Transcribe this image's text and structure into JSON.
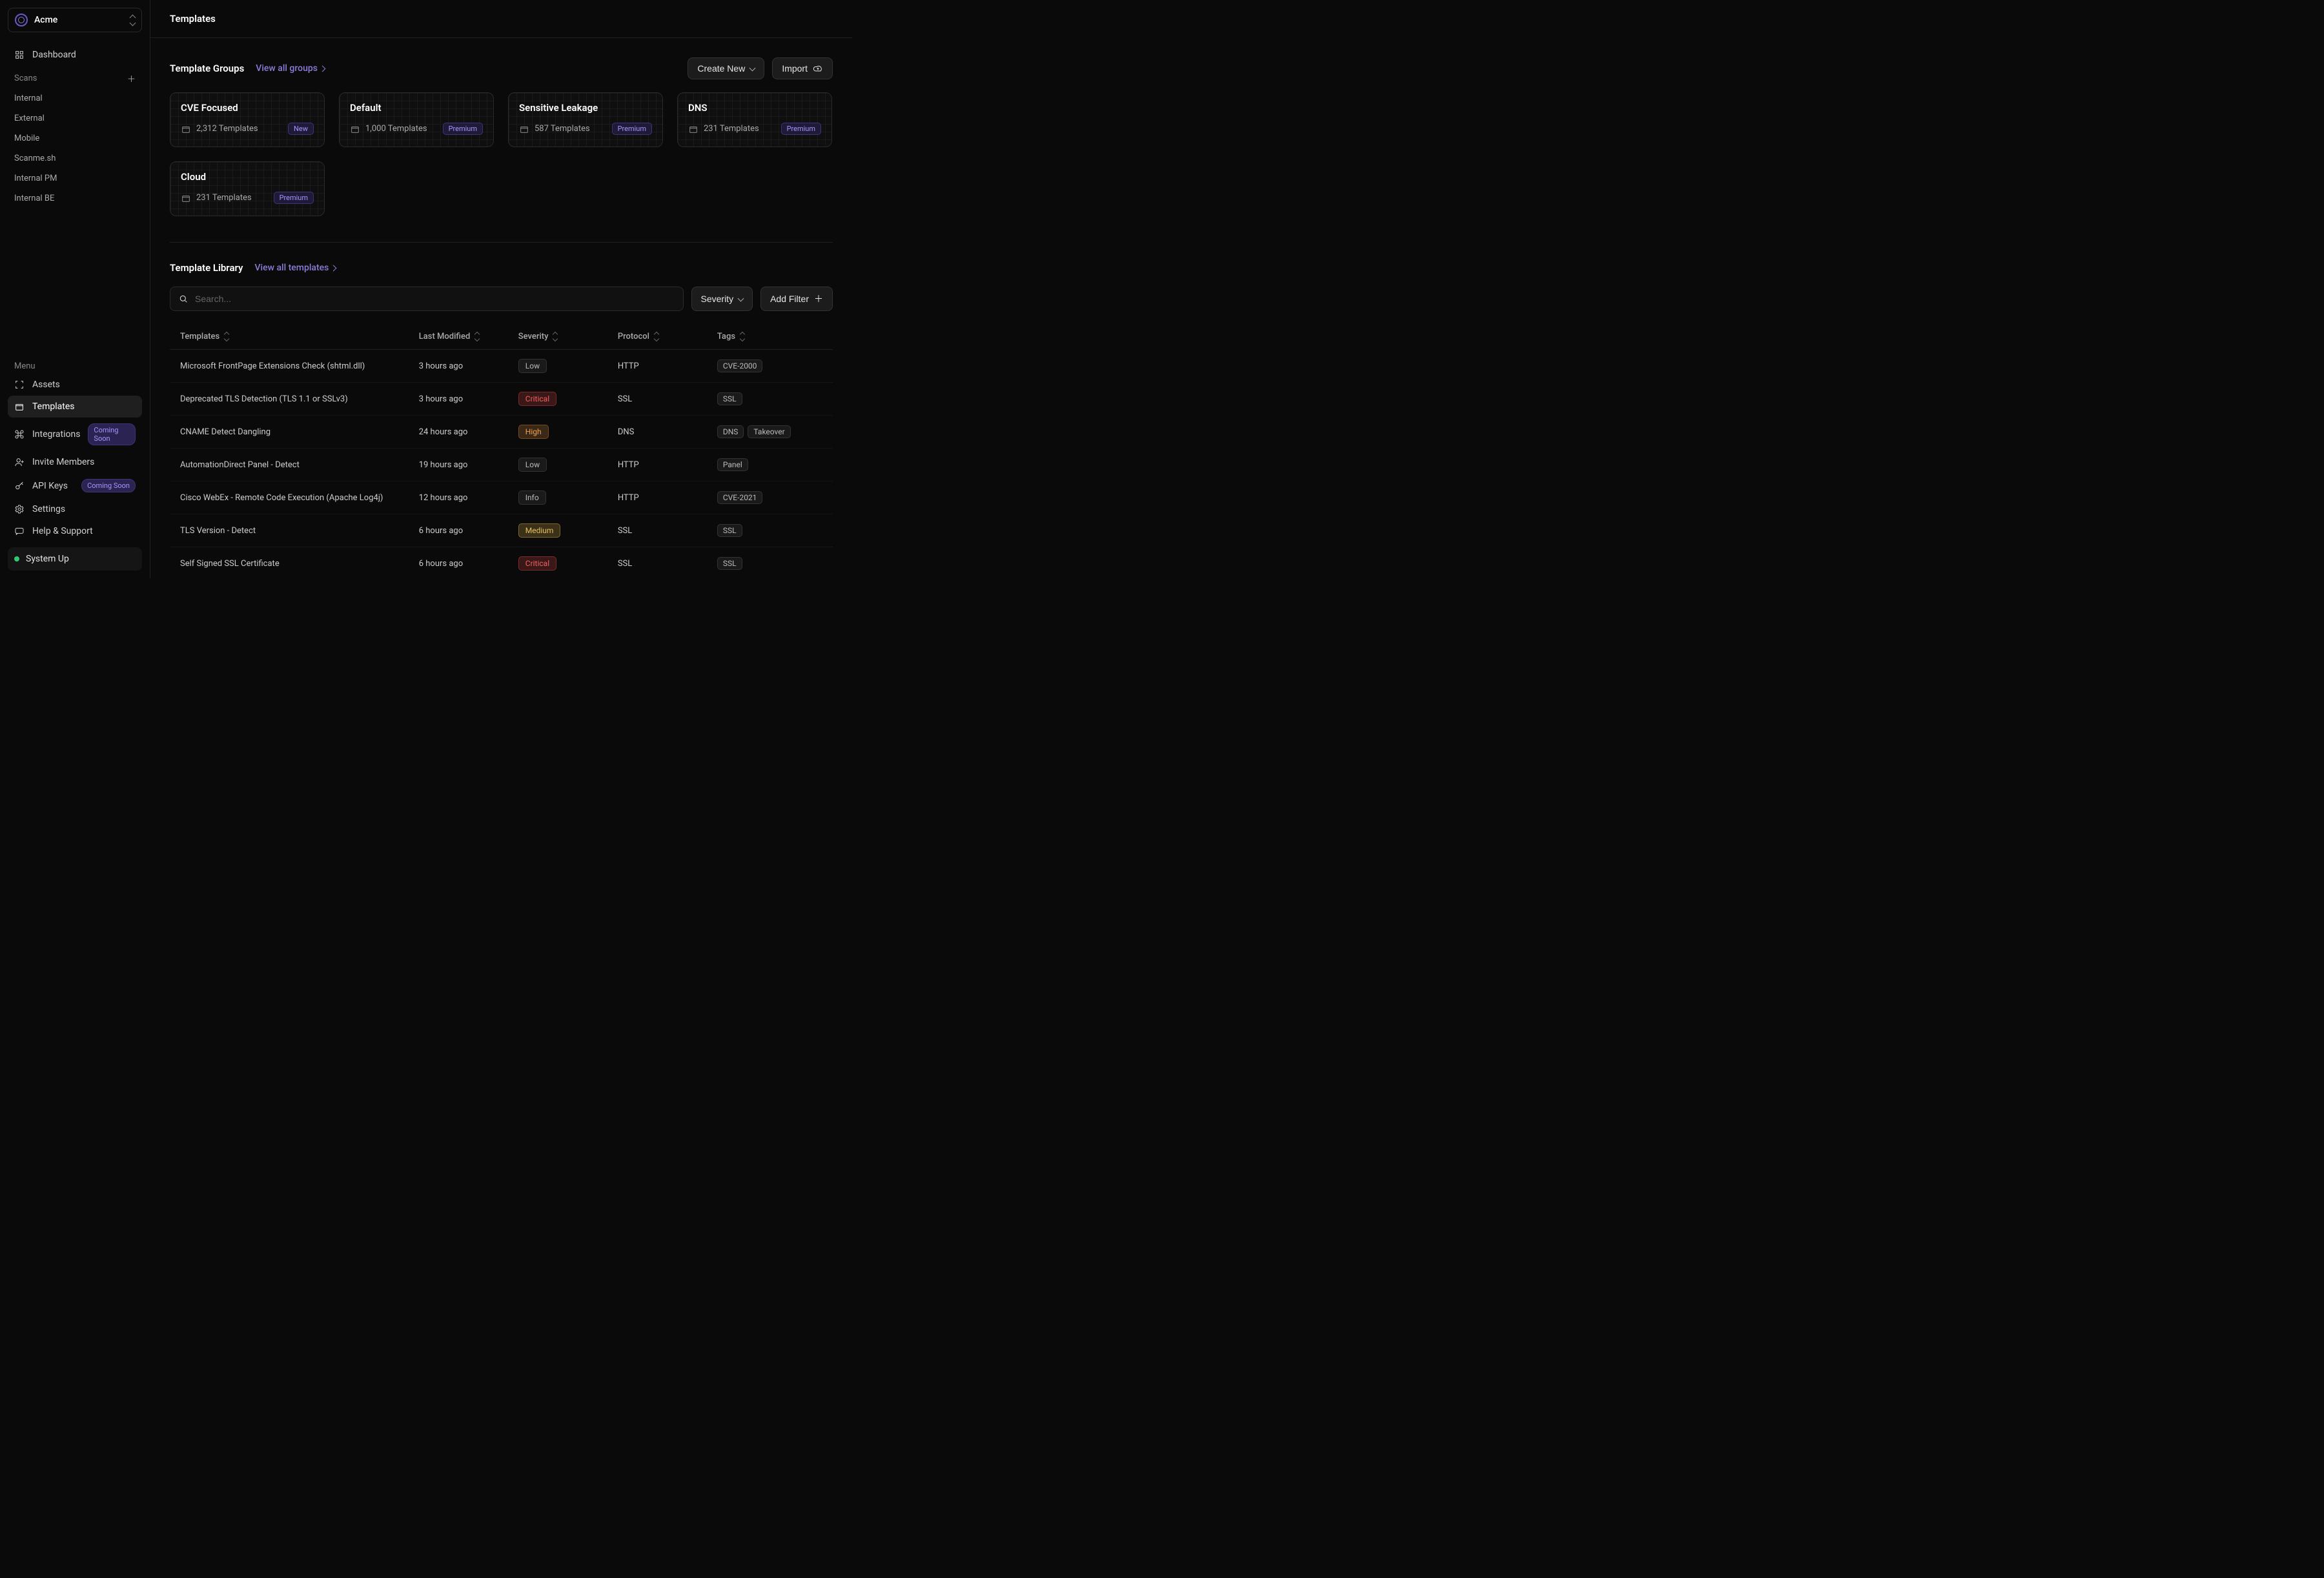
{
  "org": {
    "name": "Acme"
  },
  "sidebar": {
    "dashboard": "Dashboard",
    "scans_label": "Scans",
    "scans": [
      "Internal",
      "External",
      "Mobile",
      "Scanme.sh",
      "Internal PM",
      "Internal BE"
    ],
    "menu_label": "Menu",
    "assets": "Assets",
    "templates": "Templates",
    "integrations": "Integrations",
    "invite": "Invite Members",
    "apikeys": "API Keys",
    "settings": "Settings",
    "help": "Help & Support",
    "coming_soon": "Coming Soon",
    "system_status": "System Up"
  },
  "page": {
    "title": "Templates"
  },
  "groups": {
    "heading": "Template Groups",
    "view_all": "View all groups",
    "create_new": "Create New",
    "import": "Import",
    "cards": [
      {
        "title": "CVE Focused",
        "count": "2,312 Templates",
        "badge": "New"
      },
      {
        "title": "Default",
        "count": "1,000 Templates",
        "badge": "Premium"
      },
      {
        "title": "Sensitive Leakage",
        "count": "587 Templates",
        "badge": "Premium"
      },
      {
        "title": "DNS",
        "count": "231 Templates",
        "badge": "Premium"
      },
      {
        "title": "Cloud",
        "count": "231 Templates",
        "badge": "Premium"
      }
    ]
  },
  "library": {
    "heading": "Template Library",
    "view_all": "View all templates",
    "search_placeholder": "Search...",
    "severity_btn": "Severity",
    "add_filter": "Add Filter",
    "cols": {
      "templates": "Templates",
      "last_modified": "Last Modified",
      "severity": "Severity",
      "protocol": "Protocol",
      "tags": "Tags"
    },
    "rows": [
      {
        "name": "Microsoft FrontPage Extensions Check (shtml.dll)",
        "modified": "3 hours ago",
        "severity": "Low",
        "sev_class": "low",
        "protocol": "HTTP",
        "tags": [
          "CVE-2000"
        ]
      },
      {
        "name": "Deprecated TLS Detection (TLS 1.1 or SSLv3)",
        "modified": "3 hours ago",
        "severity": "Critical",
        "sev_class": "critical",
        "protocol": "SSL",
        "tags": [
          "SSL"
        ]
      },
      {
        "name": "CNAME Detect Dangling",
        "modified": "24 hours ago",
        "severity": "High",
        "sev_class": "high",
        "protocol": "DNS",
        "tags": [
          "DNS",
          "Takeover"
        ]
      },
      {
        "name": "AutomationDirect Panel - Detect",
        "modified": "19 hours ago",
        "severity": "Low",
        "sev_class": "low",
        "protocol": "HTTP",
        "tags": [
          "Panel"
        ]
      },
      {
        "name": "Cisco WebEx - Remote Code Execution (Apache Log4j)",
        "modified": "12 hours ago",
        "severity": "Info",
        "sev_class": "info",
        "protocol": "HTTP",
        "tags": [
          "CVE-2021"
        ]
      },
      {
        "name": "TLS Version - Detect",
        "modified": "6 hours ago",
        "severity": "Medium",
        "sev_class": "medium",
        "protocol": "SSL",
        "tags": [
          "SSL"
        ]
      },
      {
        "name": "Self Signed SSL Certificate",
        "modified": "6 hours ago",
        "severity": "Critical",
        "sev_class": "critical",
        "protocol": "SSL",
        "tags": [
          "SSL"
        ]
      }
    ]
  }
}
